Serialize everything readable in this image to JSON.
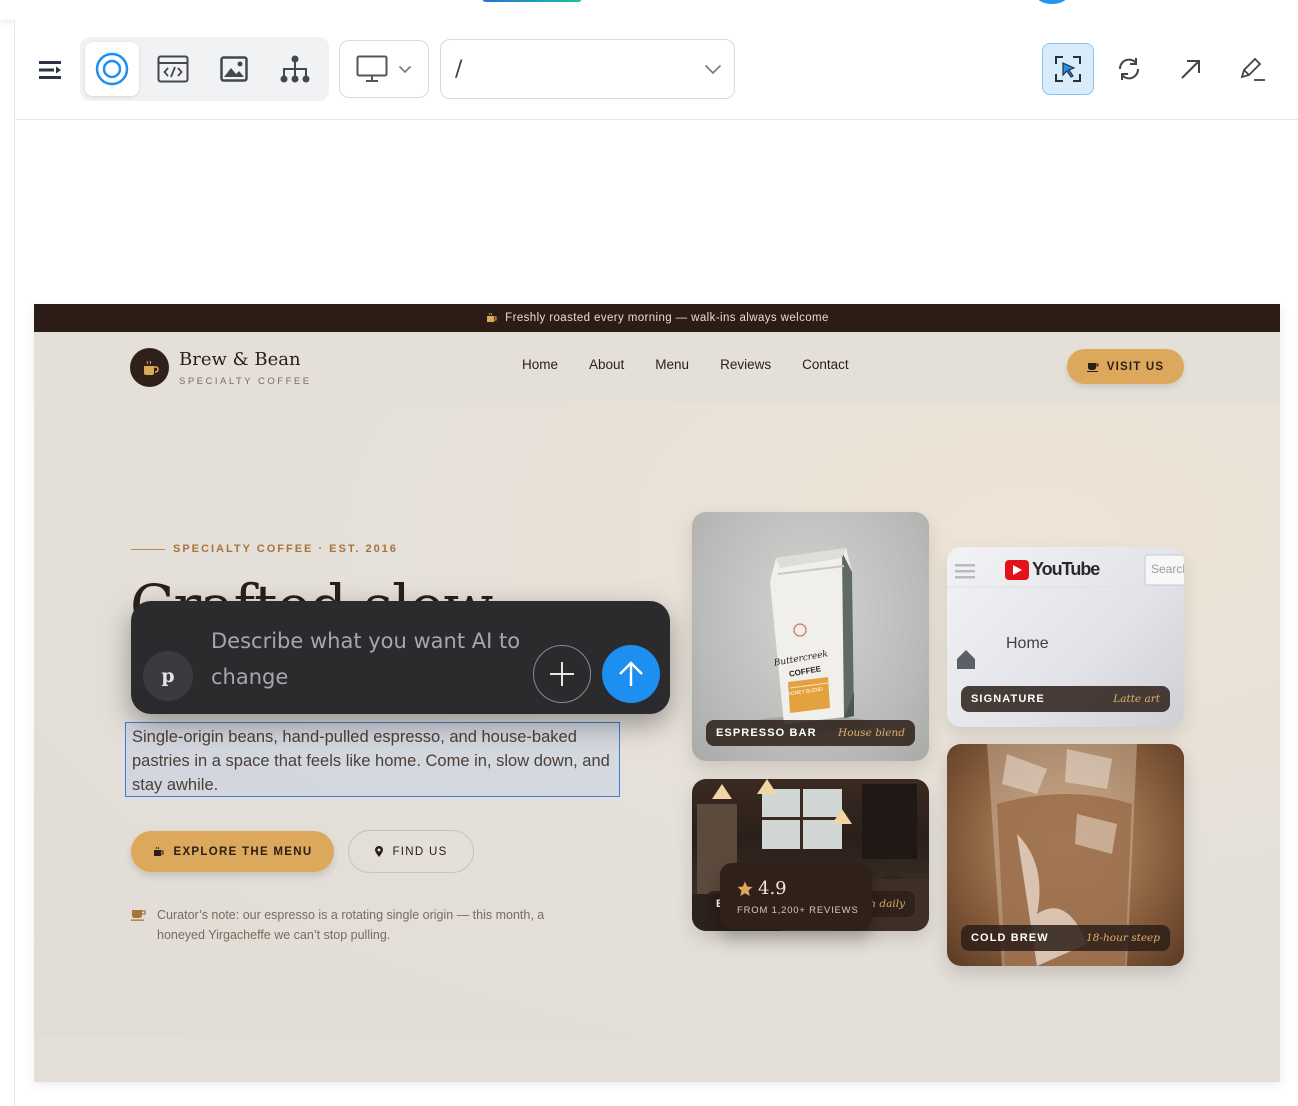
{
  "editor": {
    "route_value": "/",
    "icons": {
      "menu": "menu-collapse-icon",
      "preview": "eye-preview-icon",
      "code": "code-window-icon",
      "image": "image-icon",
      "sitemap": "sitemap-icon",
      "device": "monitor-icon",
      "select": "select-element-icon",
      "refresh": "refresh-icon",
      "open": "open-external-icon",
      "edit": "pencil-edit-icon"
    }
  },
  "site": {
    "announcement": "Freshly roasted every morning — walk-ins always welcome",
    "brand_name": "Brew & Bean",
    "brand_tagline": "SPECIALTY COFFEE",
    "nav": [
      "Home",
      "About",
      "Menu",
      "Reviews",
      "Contact"
    ],
    "visit_label": "VISIT US",
    "eyebrow": "SPECIALTY COFFEE · EST. 2016",
    "heading": "Crafted slow,",
    "subtitle": "Single-origin beans, hand-pulled espresso, and house-baked pastries in a space that feels like home. Come in, slow down, and stay awhile.",
    "cta_primary": "EXPLORE THE MENU",
    "cta_secondary": "FIND US",
    "curator_note": "Curator’s note: our espresso is a rotating single origin — this month, a honeyed Yirgacheffe we can’t stop pulling.",
    "cards": [
      {
        "title": "ESPRESSO BAR",
        "subtitle": "House blend",
        "bag_brand": "Buttercreek",
        "bag_word": "COFFEE",
        "bag_label": "HONEY BLEND"
      },
      {
        "title": "SIGNATURE",
        "subtitle": "Latte art",
        "yt_logo": "YouTube",
        "yt_search": "Search",
        "yt_home": "Home"
      },
      {
        "title": "B",
        "subtitle": "h daily"
      },
      {
        "title": "COLD BREW",
        "subtitle": "18-hour steep"
      }
    ],
    "rating": {
      "score": "4.9",
      "label": "FROM 1,200+ REVIEWS"
    },
    "colors": {
      "accent": "#dca85c",
      "dark": "#2b1d16",
      "bg": "#e4dfd8"
    }
  },
  "ai_prompt": {
    "avatar_letter": "p",
    "placeholder": "Describe what you want AI to change"
  }
}
